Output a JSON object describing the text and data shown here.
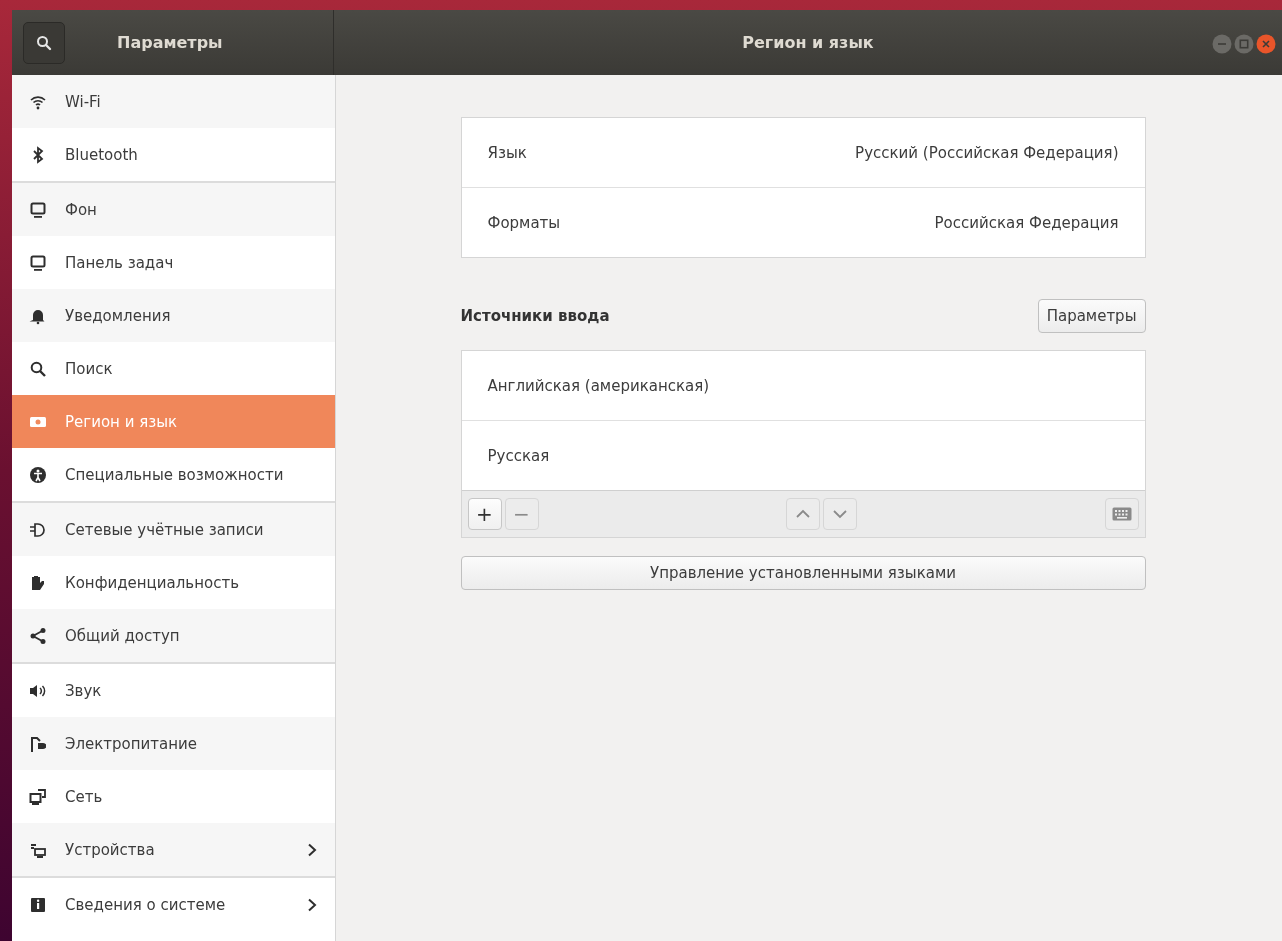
{
  "header": {
    "sidebar_title": "Параметры",
    "title": "Регион и язык"
  },
  "sidebar": {
    "groups": [
      {
        "items": [
          {
            "label": "Wi-Fi",
            "selected": false,
            "has_submenu": false
          },
          {
            "label": "Bluetooth",
            "selected": false,
            "has_submenu": false
          }
        ]
      },
      {
        "items": [
          {
            "label": "Фон",
            "selected": false,
            "has_submenu": false
          },
          {
            "label": "Панель задач",
            "selected": false,
            "has_submenu": false
          },
          {
            "label": "Уведомления",
            "selected": false,
            "has_submenu": false
          },
          {
            "label": "Поиск",
            "selected": false,
            "has_submenu": false
          },
          {
            "label": "Регион и язык",
            "selected": true,
            "has_submenu": false
          },
          {
            "label": "Специальные возможности",
            "selected": false,
            "has_submenu": false
          }
        ]
      },
      {
        "items": [
          {
            "label": "Сетевые учётные записи",
            "selected": false,
            "has_submenu": false
          },
          {
            "label": "Конфиденциальность",
            "selected": false,
            "has_submenu": false
          },
          {
            "label": "Общий доступ",
            "selected": false,
            "has_submenu": false
          }
        ]
      },
      {
        "items": [
          {
            "label": "Звук",
            "selected": false,
            "has_submenu": false
          },
          {
            "label": "Электропитание",
            "selected": false,
            "has_submenu": false
          },
          {
            "label": "Сеть",
            "selected": false,
            "has_submenu": false
          },
          {
            "label": "Устройства",
            "selected": false,
            "has_submenu": true
          }
        ]
      },
      {
        "items": [
          {
            "label": "Сведения о системе",
            "selected": false,
            "has_submenu": true
          }
        ]
      }
    ]
  },
  "settings": [
    {
      "label": "Язык",
      "value": "Русский (Российская Федерация)"
    },
    {
      "label": "Форматы",
      "value": "Российская Федерация"
    }
  ],
  "input_sources": {
    "heading": "Источники ввода",
    "options_button": "Параметры",
    "items": [
      {
        "label": "Английская (американская)"
      },
      {
        "label": "Русская"
      }
    ],
    "toolbar": [
      {
        "kind": "add",
        "text": "+",
        "disabled": false
      },
      {
        "kind": "remove",
        "text": "−",
        "disabled": true
      },
      {
        "kind": "up",
        "disabled": true
      },
      {
        "kind": "down",
        "disabled": true
      },
      {
        "kind": "keyboard",
        "disabled": true
      }
    ]
  },
  "manage_button": "Управление установленными языками"
}
